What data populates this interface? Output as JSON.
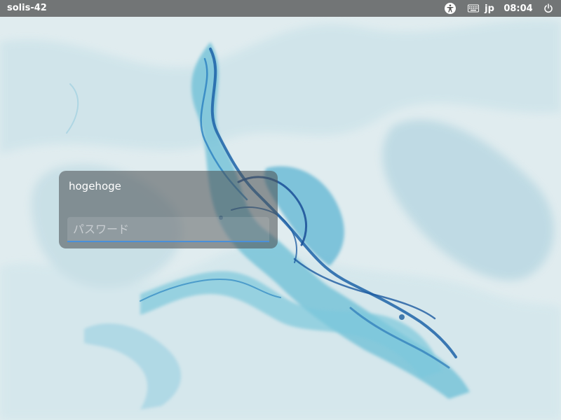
{
  "topbar": {
    "hostname": "solis-42",
    "keyboard_layout": "jp",
    "clock": "08:04",
    "icons": {
      "accessibility": "accessibility-icon",
      "keyboard": "keyboard-icon",
      "power": "power-icon"
    }
  },
  "login": {
    "username": "hogehoge",
    "password_placeholder": "パスワード",
    "password_value": ""
  },
  "colors": {
    "topbar_bg": "#464646",
    "input_underline": "#4a90d9",
    "wallpaper_base": "#dfecef",
    "wallpaper_accent": "#1e7fb8"
  }
}
